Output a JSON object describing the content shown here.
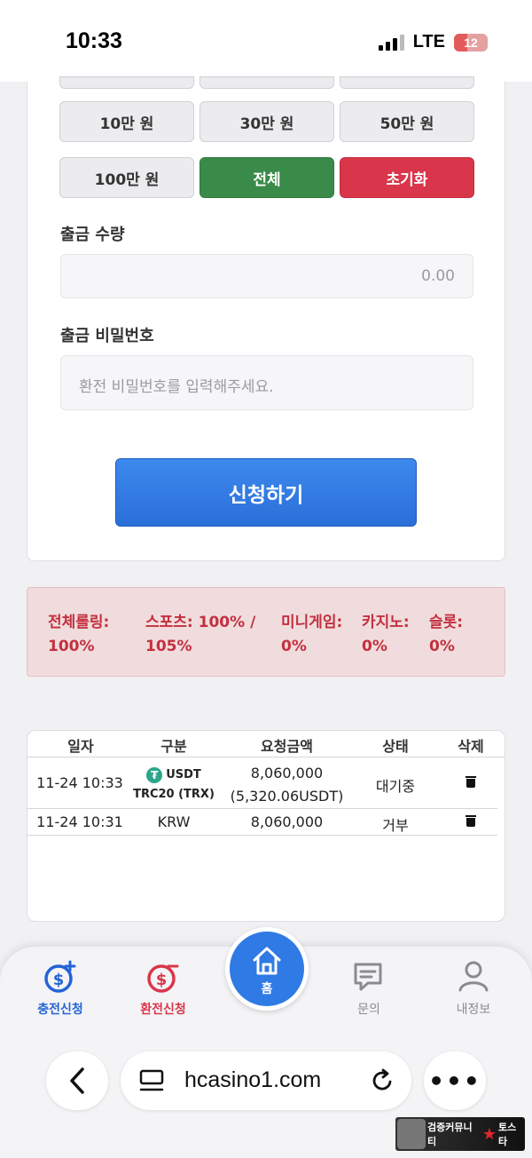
{
  "status_bar": {
    "time": "10:33",
    "network": "LTE",
    "battery": "12"
  },
  "amount_buttons": {
    "row1": [
      "10만 원",
      "30만 원",
      "50만 원"
    ],
    "row2": [
      {
        "label": "100만 원",
        "style": "default"
      },
      {
        "label": "전체",
        "style": "green"
      },
      {
        "label": "초기화",
        "style": "red"
      }
    ]
  },
  "withdraw_form": {
    "quantity_label": "출금 수량",
    "quantity_value": "0.00",
    "password_label": "출금 비밀번호",
    "password_placeholder": "환전 비밀번호를 입력해주세요.",
    "submit_label": "신청하기"
  },
  "rolling": [
    {
      "label": "전체롤링:",
      "value": "100%"
    },
    {
      "label": "스포츠: 100% /",
      "value": "105%"
    },
    {
      "label": "미니게임:",
      "value": "0%"
    },
    {
      "label": "카지노:",
      "value": "0%"
    },
    {
      "label": "슬롯:",
      "value": "0%"
    }
  ],
  "history": {
    "headers": [
      "일자",
      "구분",
      "요청금액",
      "상태",
      "삭제"
    ],
    "rows": [
      {
        "date": "11-24 10:33",
        "type_line1": "USDT",
        "type_line2": "TRC20 (TRX)",
        "amount_line1": "8,060,000",
        "amount_line2": "(5,320.06USDT)",
        "status": "대기중"
      },
      {
        "date": "11-24 10:31",
        "type_line1": "KRW",
        "type_line2": "",
        "amount_line1": "8,060,000",
        "amount_line2": "",
        "status": "거부"
      }
    ]
  },
  "bottom_nav": {
    "charge": "충전신청",
    "exchange": "환전신청",
    "home": "홈",
    "inquiry": "문의",
    "my_info": "내정보"
  },
  "browser": {
    "url": "hcasino1.com",
    "more": "•••"
  },
  "watermark": {
    "text1": "검증커뮤니티",
    "text2": "토스타"
  },
  "colors": {
    "accent_blue": "#2f7ae5",
    "green": "#3a8a4a",
    "red": "#d9364b",
    "rolling_text": "#c2303f"
  }
}
